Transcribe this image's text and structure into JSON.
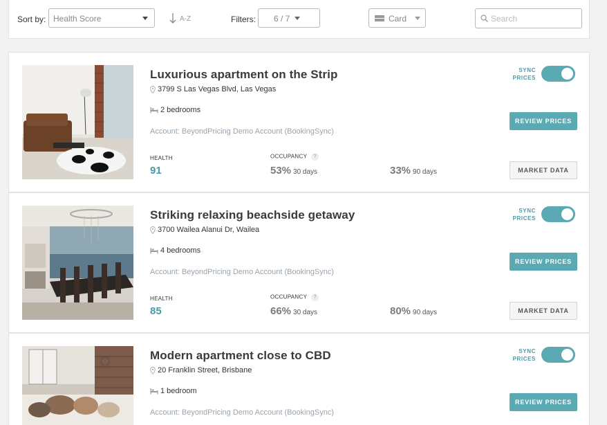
{
  "toolbar": {
    "sort_label": "Sort by:",
    "sort_value": "Health Score",
    "sort_direction": "A-Z",
    "filters_label": "Filters:",
    "filters_value": "6 / 7",
    "view_value": "Card",
    "search_placeholder": "Search"
  },
  "labels": {
    "sync": "SYNC PRICES",
    "review": "REVIEW PRICES",
    "market": "MARKET DATA",
    "health": "HEALTH",
    "occupancy": "OCCUPANCY",
    "days30": "30 days",
    "days90": "90 days"
  },
  "colors": {
    "accent": "#5aa9b3",
    "health_value": "#4a9aa5"
  },
  "listings": [
    {
      "title": "Luxurious apartment on the Strip",
      "address": "3799 S Las Vegas Blvd, Las Vegas",
      "bedrooms": "2 bedrooms",
      "account": "Account: BeyondPricing Demo Account (BookingSync)",
      "health": "91",
      "occ30": "53%",
      "occ90": "33%",
      "sync_on": true
    },
    {
      "title": "Striking relaxing beachside getaway",
      "address": "3700 Wailea Alanui Dr, Wailea",
      "bedrooms": "4 bedrooms",
      "account": "Account: BeyondPricing Demo Account (BookingSync)",
      "health": "85",
      "occ30": "66%",
      "occ90": "80%",
      "sync_on": true
    },
    {
      "title": "Modern apartment close to CBD",
      "address": "20 Franklin Street, Brisbane",
      "bedrooms": "1 bedroom",
      "account": "Account: BeyondPricing Demo Account (BookingSync)",
      "sync_on": true
    }
  ]
}
